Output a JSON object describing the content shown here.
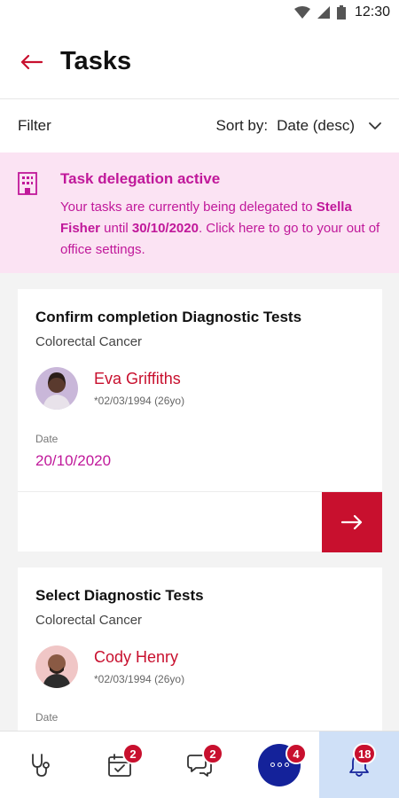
{
  "status_bar": {
    "time": "12:30"
  },
  "header": {
    "title": "Tasks"
  },
  "filter_bar": {
    "filter_label": "Filter",
    "sort_label": "Sort by:",
    "sort_value": "Date (desc)"
  },
  "delegation": {
    "title": "Task delegation active",
    "text_1": "Your tasks are currently being delegated to ",
    "delegate_name": "Stella Fisher",
    "text_2": " until ",
    "until_date": "30/10/2020",
    "text_3": ". Click here to go to your out of office settings."
  },
  "tasks": [
    {
      "title": "Confirm completion Diagnostic Tests",
      "condition": "Colorectal Cancer",
      "patient_name": "Eva Griffiths",
      "patient_dob": "*02/03/1994 (26yo)",
      "date_label": "Date",
      "date": "20/10/2020"
    },
    {
      "title": "Select Diagnostic Tests",
      "condition": "Colorectal Cancer",
      "patient_name": "Cody Henry",
      "patient_dob": "*02/03/1994 (26yo)",
      "date_label": "Date"
    }
  ],
  "bottom_nav": [
    {
      "icon": "stethoscope-icon"
    },
    {
      "icon": "calendar-check-icon",
      "badge": "2"
    },
    {
      "icon": "chat-bubbles-icon",
      "badge": "2"
    },
    {
      "icon": "profile-avatar-icon",
      "badge": "4"
    },
    {
      "icon": "bell-icon",
      "badge": "18",
      "active": true
    }
  ],
  "colors": {
    "accent_red": "#c8102e",
    "magenta": "#c0189a",
    "delegation_bg": "#fbe3f3",
    "active_nav_bg": "#cfe0f7",
    "profile_blue": "#14229a"
  }
}
